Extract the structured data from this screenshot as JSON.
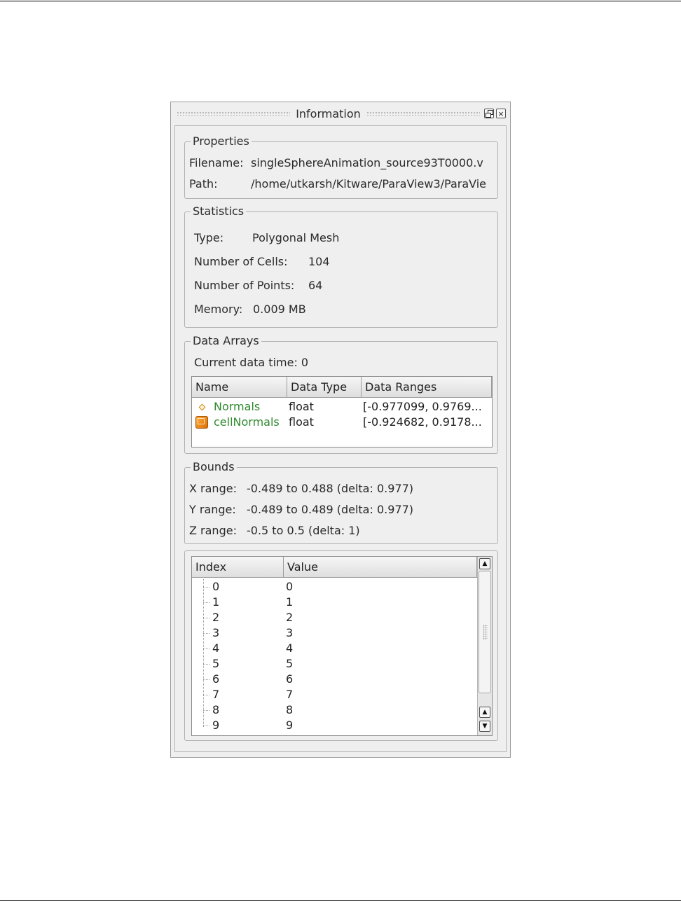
{
  "panel": {
    "title": "Information",
    "float_button": "",
    "close_button": "×"
  },
  "properties": {
    "title": "Properties",
    "filename_label": "Filename:",
    "filename_value": "singleSphereAnimation_source93T0000.v",
    "path_label": "Path:",
    "path_value": "/home/utkarsh/Kitware/ParaView3/ParaVie"
  },
  "statistics": {
    "title": "Statistics",
    "type_label": "Type:",
    "type_value": "Polygonal Mesh",
    "cells_label": "Number of Cells:",
    "cells_value": "104",
    "points_label": "Number of Points:",
    "points_value": "64",
    "memory_label": "Memory:",
    "memory_value": "0.009 MB"
  },
  "data_arrays": {
    "title": "Data Arrays",
    "current_time": "Current data time: 0",
    "columns": [
      "Name",
      "Data Type",
      "Data Ranges"
    ],
    "rows": [
      {
        "icon": "point-data-icon",
        "name": "Normals",
        "type": "float",
        "range": "[-0.977099, 0.9769..."
      },
      {
        "icon": "cell-data-icon",
        "name": "cellNormals",
        "type": "float",
        "range": "[-0.924682, 0.9178..."
      }
    ]
  },
  "bounds": {
    "title": "Bounds",
    "x_label": "X range:",
    "x_value": "-0.489 to 0.488 (delta: 0.977)",
    "y_label": "Y range:",
    "y_value": "-0.489 to 0.489 (delta: 0.977)",
    "z_label": "Z range:",
    "z_value": "-0.5 to 0.5 (delta: 1)"
  },
  "time_table": {
    "columns": [
      "Index",
      "Value"
    ],
    "rows": [
      {
        "index": "0",
        "value": "0"
      },
      {
        "index": "1",
        "value": "1"
      },
      {
        "index": "2",
        "value": "2"
      },
      {
        "index": "3",
        "value": "3"
      },
      {
        "index": "4",
        "value": "4"
      },
      {
        "index": "5",
        "value": "5"
      },
      {
        "index": "6",
        "value": "6"
      },
      {
        "index": "7",
        "value": "7"
      },
      {
        "index": "8",
        "value": "8"
      },
      {
        "index": "9",
        "value": "9"
      }
    ],
    "scroll_up": "▲",
    "scroll_down": "▼"
  }
}
